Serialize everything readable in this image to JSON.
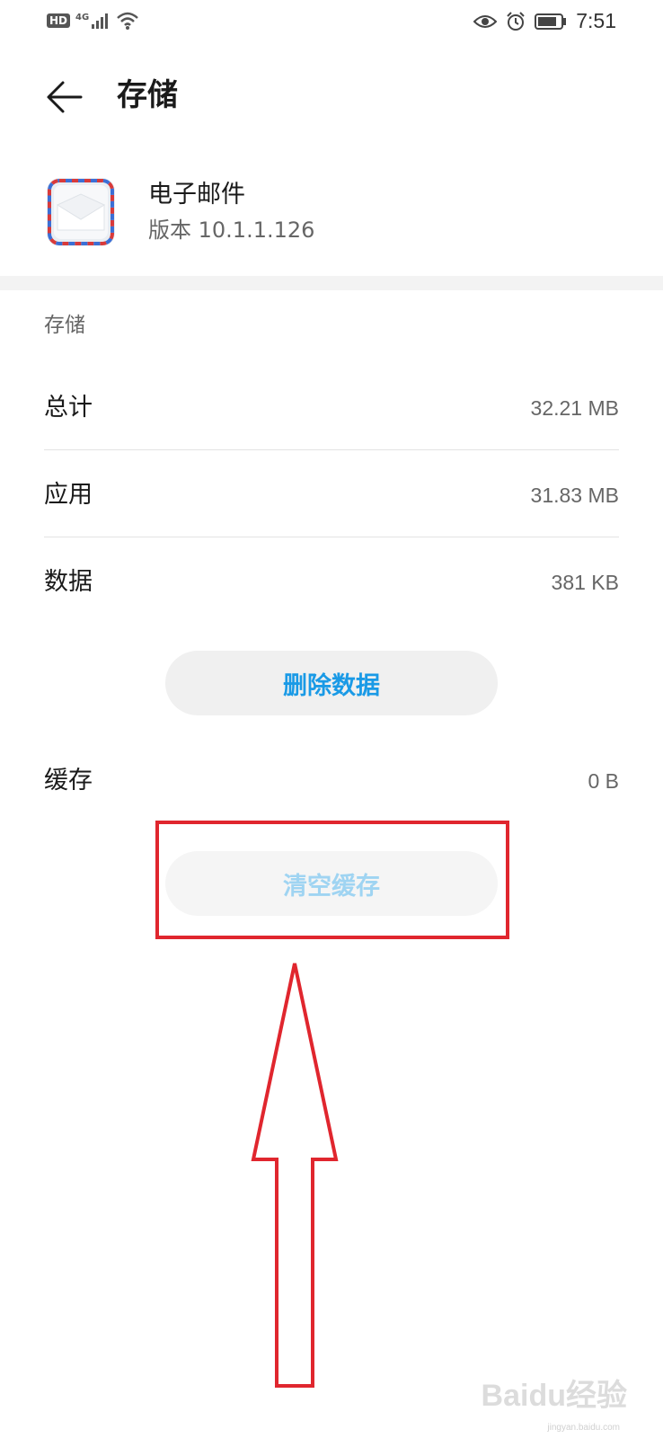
{
  "status_bar": {
    "hd_label": "HD",
    "network_label": "4G",
    "time": "7:51"
  },
  "header": {
    "title": "存储"
  },
  "app": {
    "name": "电子邮件",
    "version": "版本 10.1.1.126"
  },
  "storage": {
    "section_label": "存储",
    "rows": [
      {
        "label": "总计",
        "value": "32.21 MB"
      },
      {
        "label": "应用",
        "value": "31.83 MB"
      },
      {
        "label": "数据",
        "value": "381 KB"
      }
    ],
    "delete_data_button": "删除数据"
  },
  "cache": {
    "label": "缓存",
    "value": "0 B",
    "clear_cache_button": "清空缓存"
  },
  "watermark": {
    "text": "Baidu经验",
    "sub": "jingyan.baidu.com"
  },
  "colors": {
    "accent": "#1a9ae6",
    "accent_disabled": "#9fd4f2",
    "annotation_red": "#e0262e"
  }
}
